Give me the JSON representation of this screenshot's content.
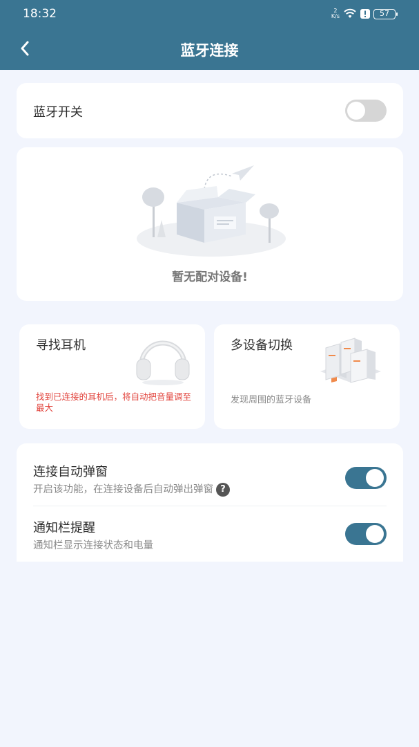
{
  "status_bar": {
    "time": "18:32",
    "net_speed_value": "2",
    "net_speed_unit": "K/s",
    "battery": "57"
  },
  "header": {
    "title": "蓝牙连接"
  },
  "bluetooth_switch": {
    "label": "蓝牙开关",
    "state": "off"
  },
  "paired_devices": {
    "empty_text": "暂无配对设备!"
  },
  "features": [
    {
      "title": "寻找耳机",
      "description": "找到已连接的耳机后，将自动把音量调至最大",
      "icon": "headphones-icon"
    },
    {
      "title": "多设备切换",
      "description": "发现周围的蓝牙设备",
      "icon": "devices-icon"
    }
  ],
  "settings": [
    {
      "title": "连接自动弹窗",
      "subtitle": "开启该功能，在连接设备后自动弹出弹窗",
      "state": "on"
    },
    {
      "title": "通知栏提醒",
      "subtitle": "通知栏显示连接状态和电量",
      "state": "on"
    }
  ],
  "colors": {
    "header": "#3a7592",
    "toggle_on": "#3a7592",
    "toggle_off": "#d6d6d6",
    "warning_text": "#e2463f",
    "background": "#f2f5fd"
  }
}
